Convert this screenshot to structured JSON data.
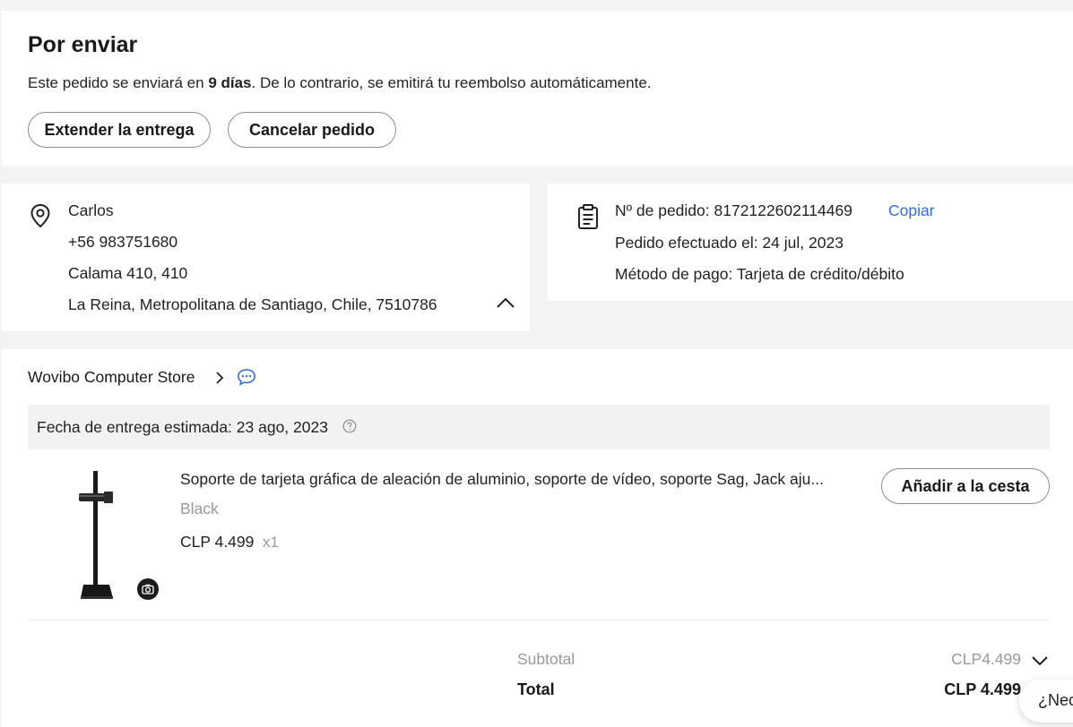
{
  "status": {
    "title": "Por enviar",
    "message_prefix": "Este pedido se enviará en ",
    "message_days": "9 días",
    "message_suffix": ". De lo contrario, se emitirá tu reembolso automáticamente.",
    "extend_label": "Extender la entrega",
    "cancel_label": "Cancelar pedido"
  },
  "address": {
    "icon": "location-pin-icon",
    "name": "Carlos",
    "phone": "+56 983751680",
    "street": "Calama 410, 410",
    "region": "La Reina, Metropolitana de Santiago, Chile, 7510786"
  },
  "order_info": {
    "icon": "clipboard-icon",
    "order_number": "Nº de pedido: 8172122602114469",
    "copy_label": "Copiar",
    "placed_on": "Pedido efectuado el: 24 jul, 2023",
    "payment_method": "Método de pago: Tarjeta de crédito/débito"
  },
  "store": {
    "name": "Wovibo Computer Store",
    "delivery_estimate": "Fecha de entrega estimada: 23 ago, 2023",
    "item": {
      "title": "Soporte de tarjeta gráfica de aleación de aluminio, soporte de vídeo, soporte Sag, Jack aju...",
      "variant": "Black",
      "price": "CLP 4.499",
      "quantity": "x1",
      "add_to_cart_label": "Añadir a la cesta"
    },
    "summary": {
      "subtotal_label": "Subtotal",
      "subtotal_value": "CLP4.499",
      "total_label": "Total",
      "total_value": "CLP 4.499"
    }
  },
  "help": {
    "label": "¿Nec"
  },
  "colors": {
    "link": "#2e6fd6",
    "background": "#f3f3f3",
    "muted_text": "#999999"
  }
}
